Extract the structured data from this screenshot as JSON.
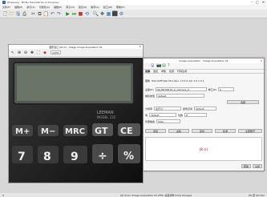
{
  "window": {
    "title": "HDevelop - MVTec HALCON 20.11 Progress",
    "min": "–",
    "max": "□",
    "close": "✕"
  },
  "menus": [
    "文件(F)",
    "编辑(E)",
    "执行(X)",
    "可视化(V)",
    "函数(P)",
    "算子(O)",
    "建议(S)",
    "助手(A)",
    "窗口(W)",
    "帮助(H)"
  ],
  "toolbar_icons": [
    "new-icon",
    "open-icon",
    "save-icon",
    "print-icon",
    "cut-icon",
    "copy-icon",
    "paste-icon",
    "undo-icon",
    "redo-icon",
    "run-icon",
    "step-icon",
    "stop-icon",
    "reset-icon",
    "zoom-icon",
    "pan-icon",
    "region-icon",
    "graphics-icon",
    "assistant-icon"
  ],
  "image_window": {
    "title": "图形窗口 (ID:0) - Image Image Acquisition 01",
    "zoom": "100%",
    "tool_icons": [
      "select-icon",
      "zoom-in-icon",
      "zoom-out-icon",
      "move-icon",
      "fit-icon",
      "color-icon"
    ],
    "calc_keys_row1": [
      "M+",
      "M−",
      "MRC",
      "GT",
      "CE"
    ],
    "calc_keys_row2": [
      "7",
      "8",
      "9",
      "÷",
      "%"
    ],
    "calc_brand": "LEEMAN",
    "calc_model": "MODEL 13C"
  },
  "dialog": {
    "title": "Image Acquisition : Image Acquisition 01",
    "tabs": [
      "资源",
      "连接",
      "参数",
      "检测",
      "代码生成"
    ],
    "active_tab": "资源",
    "interface_label": "图像",
    "interface_value": "HalconEFrate 30.1 Rev: 13 0 0.1rp 1 0 1 0 1",
    "device_label": "设备(D)",
    "device_value": "[0] PPUSB-01_0_Camera_0",
    "port_label": "端口(P)",
    "port_value": "0",
    "camera_type_label": "相机类型",
    "camera_type_value": "default",
    "resolution_label": "分辨率",
    "resolution_value": "全尺寸",
    "color_space_label": "颜色空间",
    "color_space_value": "default",
    "bit_depth_label": "位数",
    "bit_depth_value": "8",
    "field_label": "场",
    "field_value": "default",
    "trigger_label": "外部触发",
    "trigger_value": "false",
    "select_button": "选择",
    "buttons": [
      "连接",
      "采集",
      "实时",
      "检测",
      "全部断开"
    ],
    "log_text": "(8 ②)",
    "help_button": "帮助",
    "close_button": "关闭"
  },
  "statusbar": {
    "left": "0",
    "middle": "[0] Scan: Image Acquisition 01 (FPS: 采集帧率 8 f/s) [Image]",
    "right": "[0] 原 [0] 50x"
  }
}
